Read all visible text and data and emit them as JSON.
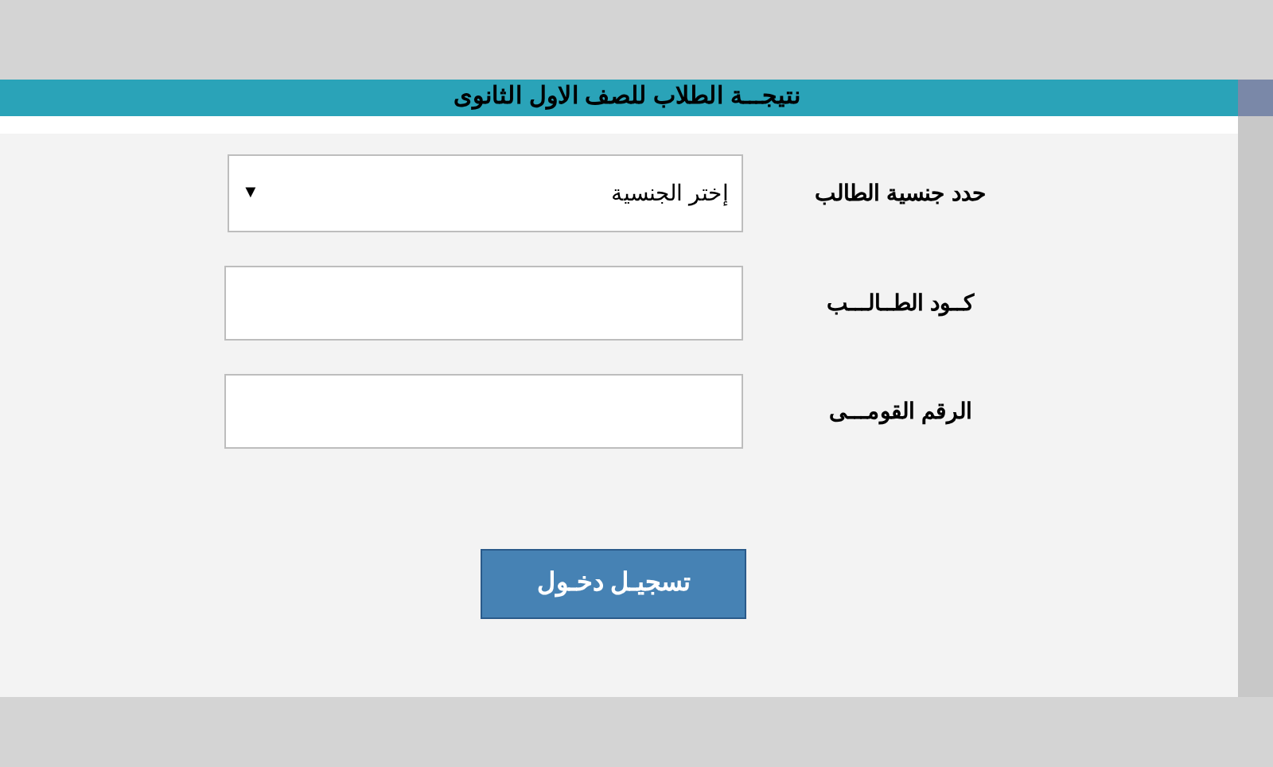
{
  "header": {
    "title": "نتيجـــة الطلاب للصف الاول الثانوى"
  },
  "fields": [
    {
      "kind": "select",
      "label": "حدد جنسية الطالب",
      "value": "إختر الجنسية",
      "arrow": "▼"
    },
    {
      "kind": "text",
      "label": "كــود الطــالـــب"
    },
    {
      "kind": "text",
      "label": "الرقم القومـــى"
    }
  ],
  "submit": {
    "label": "تسجيـل دخـول"
  }
}
